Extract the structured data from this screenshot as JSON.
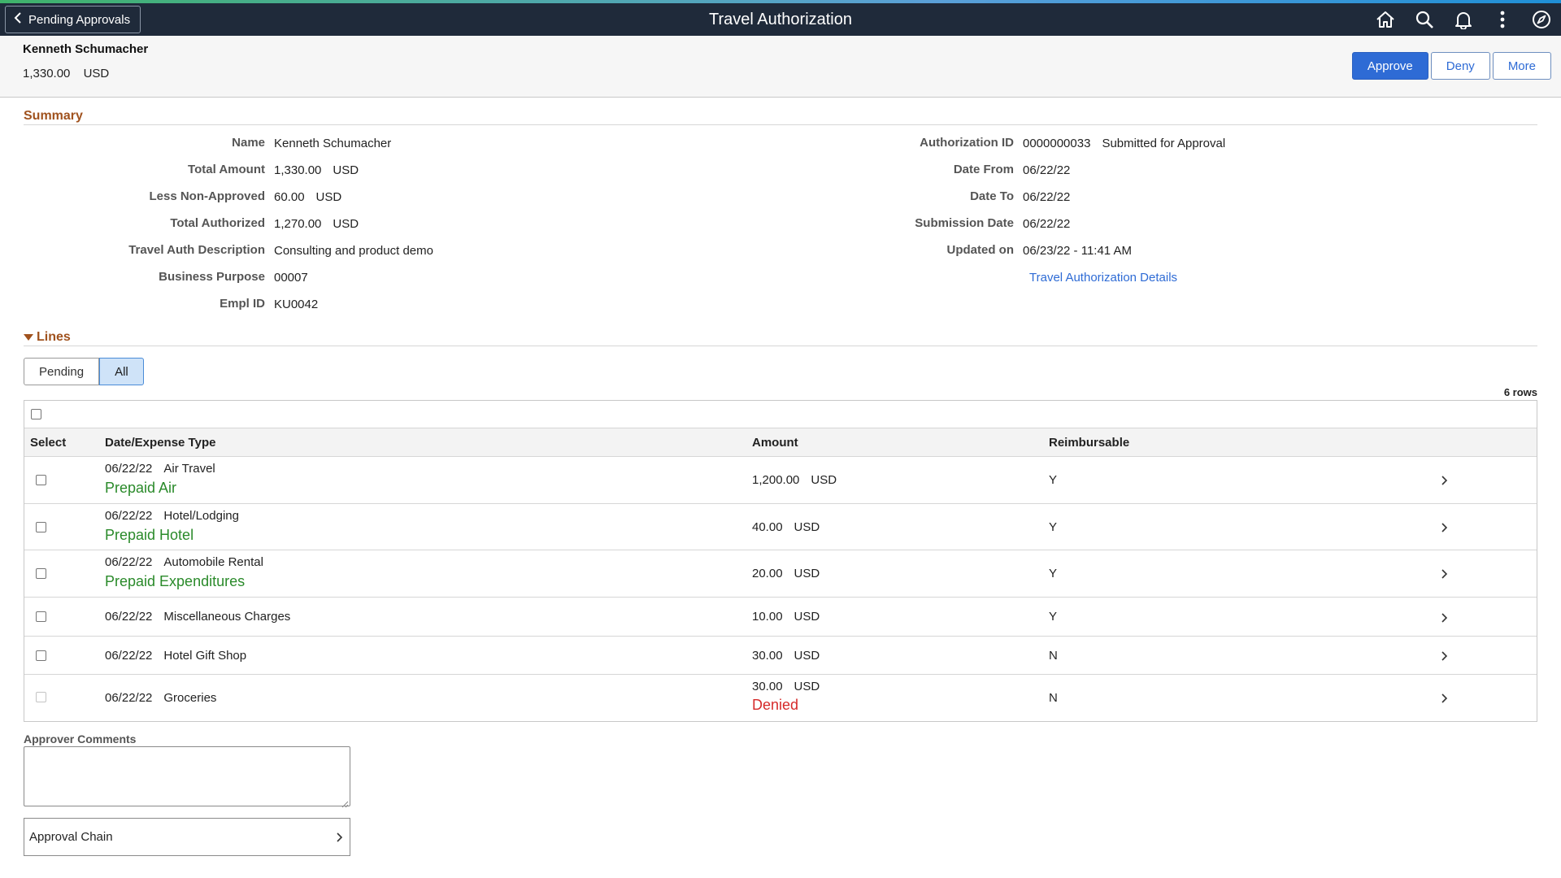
{
  "banner": {
    "back_label": "Pending Approvals",
    "title": "Travel Authorization",
    "icons": [
      "home-icon",
      "search-icon",
      "bell-icon",
      "more-vertical-icon",
      "compass-icon"
    ]
  },
  "header": {
    "name": "Kenneth Schumacher",
    "amount": "1,330.00",
    "currency": "USD",
    "approve_label": "Approve",
    "deny_label": "Deny",
    "more_label": "More"
  },
  "summary": {
    "title": "Summary",
    "left": [
      {
        "label": "Name",
        "value": "Kenneth Schumacher",
        "unit": ""
      },
      {
        "label": "Total Amount",
        "value": "1,330.00",
        "unit": "USD"
      },
      {
        "label": "Less Non-Approved",
        "value": "60.00",
        "unit": "USD"
      },
      {
        "label": "Total Authorized",
        "value": "1,270.00",
        "unit": "USD"
      },
      {
        "label": "Travel Auth Description",
        "value": "Consulting and product demo",
        "unit": ""
      },
      {
        "label": "Business Purpose",
        "value": "00007",
        "unit": ""
      },
      {
        "label": "Empl ID",
        "value": "KU0042",
        "unit": ""
      }
    ],
    "right": [
      {
        "label": "Authorization ID",
        "value": "0000000033",
        "unit": "Submitted for Approval"
      },
      {
        "label": "Date From",
        "value": "06/22/22",
        "unit": ""
      },
      {
        "label": "Date To",
        "value": "06/22/22",
        "unit": ""
      },
      {
        "label": "Submission Date",
        "value": "06/22/22",
        "unit": ""
      },
      {
        "label": "Updated on",
        "value": "06/23/22 - 11:41 AM",
        "unit": ""
      }
    ],
    "details_link": "Travel Authorization Details"
  },
  "lines": {
    "title": "Lines",
    "seg_pending": "Pending",
    "seg_all": "All",
    "rows_count": "6 rows",
    "columns": [
      "Select",
      "Date/Expense Type",
      "Amount",
      "Reimbursable"
    ],
    "rows": [
      {
        "date": "06/22/22",
        "type": "Air Travel",
        "sub": "Prepaid Air",
        "amount": "1,200.00",
        "currency": "USD",
        "status": "",
        "reimb": "Y"
      },
      {
        "date": "06/22/22",
        "type": "Hotel/Lodging",
        "sub": "Prepaid Hotel",
        "amount": "40.00",
        "currency": "USD",
        "status": "",
        "reimb": "Y"
      },
      {
        "date": "06/22/22",
        "type": "Automobile Rental",
        "sub": "Prepaid Expenditures",
        "amount": "20.00",
        "currency": "USD",
        "status": "",
        "reimb": "Y"
      },
      {
        "date": "06/22/22",
        "type": "Miscellaneous Charges",
        "sub": "",
        "amount": "10.00",
        "currency": "USD",
        "status": "",
        "reimb": "Y"
      },
      {
        "date": "06/22/22",
        "type": "Hotel Gift Shop",
        "sub": "",
        "amount": "30.00",
        "currency": "USD",
        "status": "",
        "reimb": "N"
      },
      {
        "date": "06/22/22",
        "type": "Groceries",
        "sub": "",
        "amount": "30.00",
        "currency": "USD",
        "status": "Denied",
        "reimb": "N"
      }
    ]
  },
  "comments": {
    "label": "Approver Comments",
    "value": ""
  },
  "approval_chain": {
    "label": "Approval Chain"
  }
}
